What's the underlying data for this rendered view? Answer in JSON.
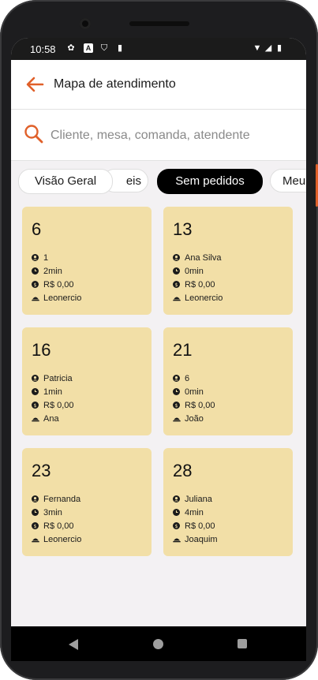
{
  "status": {
    "time": "10:58"
  },
  "appbar": {
    "title": "Mapa de atendimento"
  },
  "search": {
    "placeholder": "Cliente, mesa, comanda, atendente"
  },
  "chips": [
    {
      "label": "Visão Geral",
      "active": false
    },
    {
      "label": "eis",
      "active": false
    },
    {
      "label": "Sem pedidos",
      "active": true
    },
    {
      "label": "Meu",
      "active": false
    }
  ],
  "tables": [
    {
      "number": "6",
      "person": "1",
      "time": "2min",
      "amount": "R$ 0,00",
      "waiter": "Leonercio"
    },
    {
      "number": "13",
      "person": "Ana Silva",
      "time": "0min",
      "amount": "R$ 0,00",
      "waiter": "Leonercio"
    },
    {
      "number": "16",
      "person": "Patricia",
      "time": "1min",
      "amount": "R$ 0,00",
      "waiter": "Ana"
    },
    {
      "number": "21",
      "person": "6",
      "time": "0min",
      "amount": "R$ 0,00",
      "waiter": "João"
    },
    {
      "number": "23",
      "person": "Fernanda",
      "time": "3min",
      "amount": "R$ 0,00",
      "waiter": "Leonercio"
    },
    {
      "number": "28",
      "person": "Juliana",
      "time": "4min",
      "amount": "R$ 0,00",
      "waiter": "Joaquim"
    }
  ],
  "colors": {
    "accent": "#e0602a",
    "card": "#f2dfa7",
    "active_chip": "#000000"
  }
}
